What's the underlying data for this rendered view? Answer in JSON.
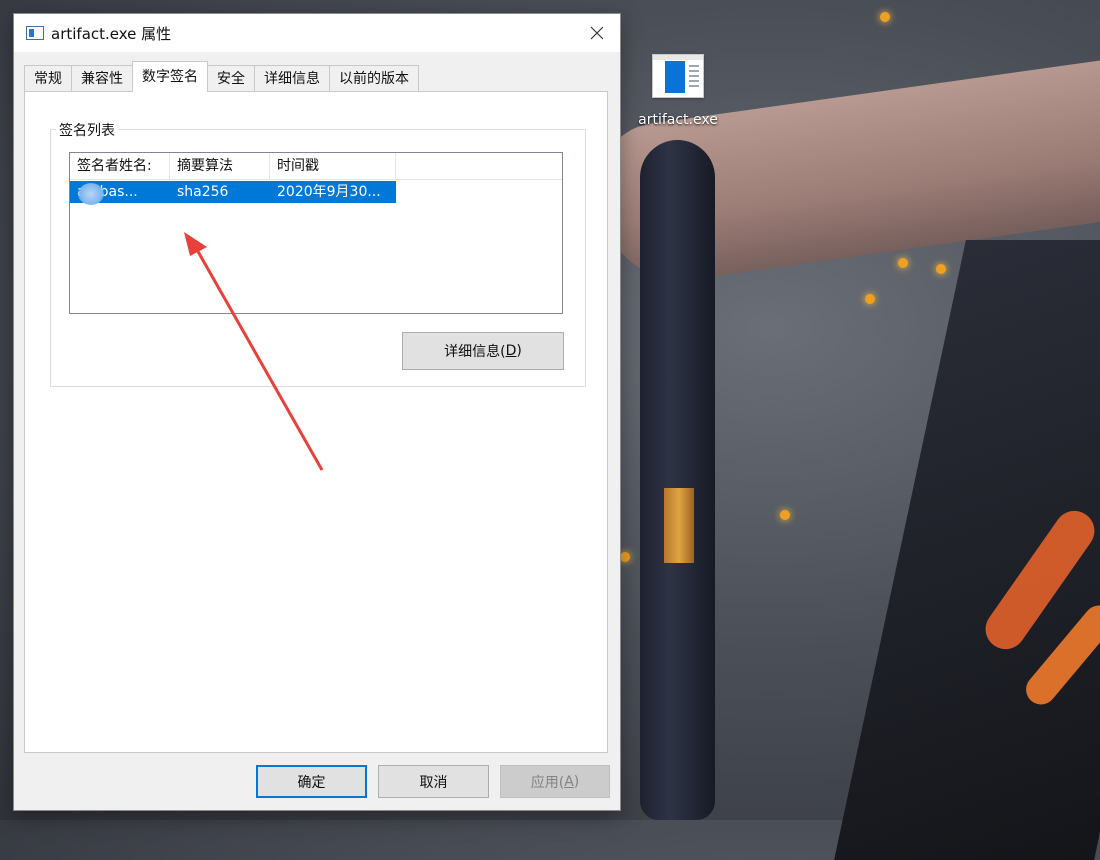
{
  "window": {
    "title": "artifact.exe 属性",
    "tabs": [
      "常规",
      "兼容性",
      "数字签名",
      "安全",
      "详细信息",
      "以前的版本"
    ],
    "active_tab": "数字签名"
  },
  "signature_list": {
    "group_title": "签名列表",
    "columns": [
      "签名者姓名:",
      "摘要算法",
      "时间戳"
    ],
    "rows": [
      {
        "signer": "atabas...",
        "digest": "sha256",
        "timestamp": "2020年9月30..."
      }
    ],
    "details_button": {
      "label": "详细信息(",
      "mnemonic": "D",
      "suffix": ")"
    }
  },
  "footer": {
    "ok": "确定",
    "cancel": "取消",
    "apply": {
      "label": "应用(",
      "mnemonic": "A",
      "suffix": ")"
    }
  },
  "desktop": {
    "icon_label": "artifact.exe",
    "icon_name": "exe-file-icon"
  },
  "colors": {
    "selection": "#0078d7",
    "arrow": "#e8403a"
  }
}
